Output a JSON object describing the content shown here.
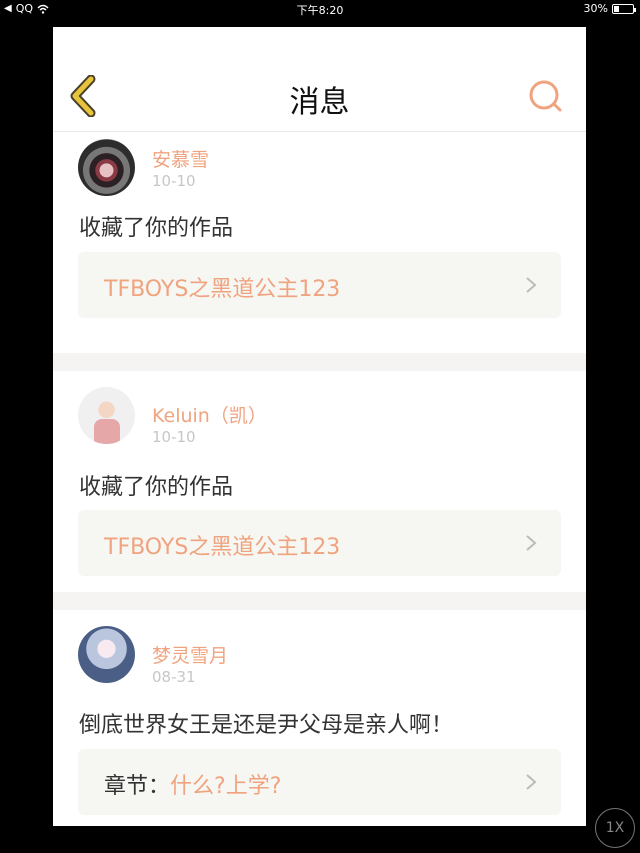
{
  "status_bar": {
    "back_app": "QQ",
    "time": "下午8:20",
    "battery": "30%",
    "battery_level": 0.3
  },
  "navbar": {
    "title": "消息"
  },
  "messages": [
    {
      "username": "安慕雪",
      "date": "10-10",
      "action": "收藏了你的作品",
      "work_title": "TFBOYS之黑道公主123"
    },
    {
      "username": "Keluin（凯）",
      "date": "10-10",
      "action": "收藏了你的作品",
      "work_title": "TFBOYS之黑道公主123"
    },
    {
      "username": "梦灵雪月",
      "date": "08-31",
      "action": "倒底世界女王是还是尹父母是亲人啊！",
      "work_prefix": "章节：",
      "work_title": "什么?上学?"
    }
  ],
  "zoom_label": "1X",
  "colors": {
    "accent": "#f0a37f",
    "back_arrow": "#e7c43c",
    "card_bg": "#f6f6f2"
  }
}
